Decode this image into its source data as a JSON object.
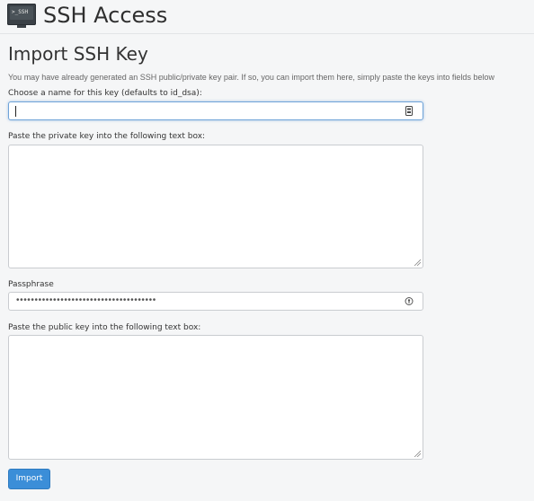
{
  "header": {
    "icon_text": ">_SSH",
    "title": "SSH Access"
  },
  "import_section": {
    "title": "Import SSH Key",
    "intro": "You may have already generated an SSH public/private key pair. If so, you can import them here, simply paste the keys into fields below",
    "name_label": "Choose a name for this key (defaults to id_dsa):",
    "name_value": "",
    "private_key_label": "Paste the private key into the following text box:",
    "private_key_value": "",
    "passphrase_label": "Passphrase",
    "passphrase_mask": "••••••••••••••••••••••••••••••••••••••",
    "public_key_label": "Paste the public key into the following text box:",
    "public_key_value": "",
    "import_button": "Import"
  },
  "icons": {
    "name_field": "password-manager-icon",
    "passphrase_field": "key-icon"
  },
  "colors": {
    "primary_button": "#3b8ed8",
    "focus_border": "#6fa3d8"
  }
}
